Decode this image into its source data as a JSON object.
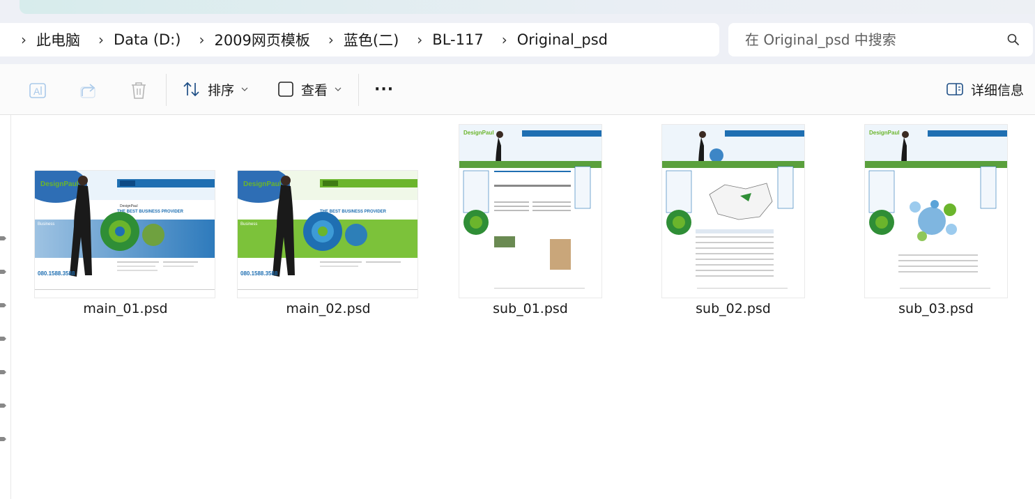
{
  "breadcrumb": {
    "items": [
      "此电脑",
      "Data (D:)",
      "2009网页模板",
      "蓝色(二)",
      "BL-117",
      "Original_psd"
    ]
  },
  "search": {
    "placeholder": "在 Original_psd 中搜索"
  },
  "toolbar": {
    "sort_label": "排序",
    "view_label": "查看",
    "more_label": "···",
    "details_label": "详细信息"
  },
  "files": [
    {
      "name": "main_01.psd",
      "theme": "blue-main"
    },
    {
      "name": "main_02.psd",
      "theme": "green-main"
    },
    {
      "name": "sub_01.psd",
      "theme": "sub-text"
    },
    {
      "name": "sub_02.psd",
      "theme": "sub-map"
    },
    {
      "name": "sub_03.psd",
      "theme": "sub-bubbles"
    }
  ],
  "thumb_text": {
    "logo": "DesignPaul",
    "tagline": "THE BEST BUSINESS PROVIDER",
    "phone": "080.1588.3588"
  },
  "colors": {
    "accent_blue": "#1f6fb2",
    "accent_green": "#6bb52c",
    "toolbar_bg": "#fbfbfb",
    "chrome_bg": "#eef0f6"
  }
}
